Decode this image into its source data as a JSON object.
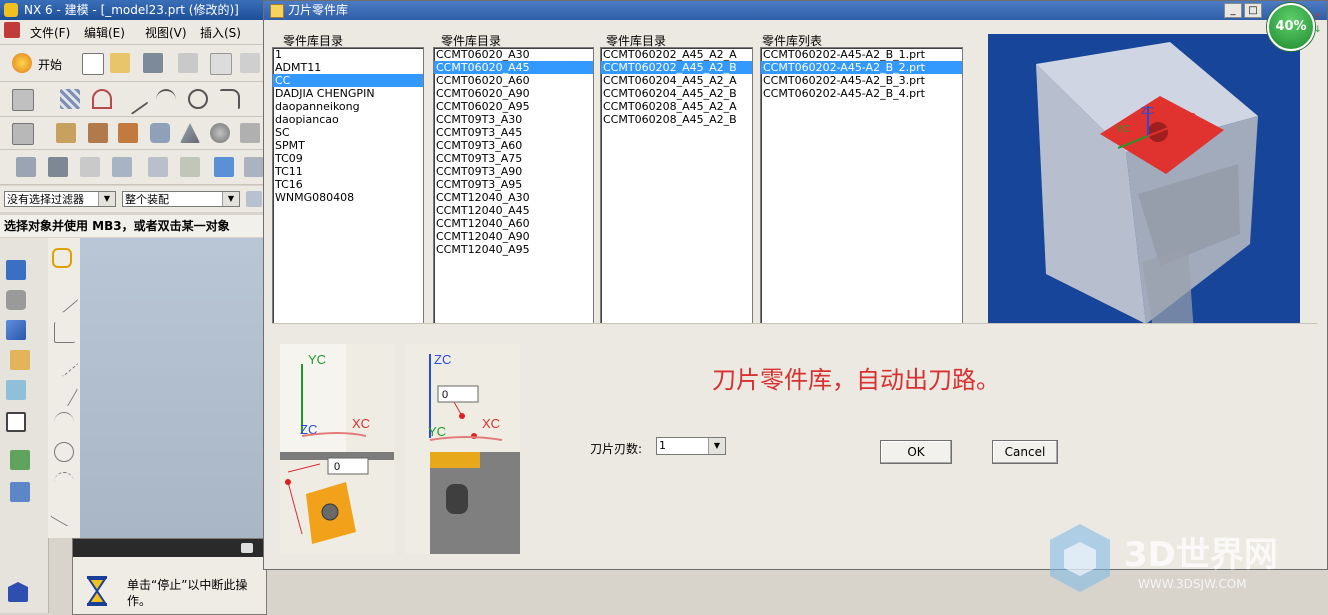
{
  "app": {
    "title": "NX 6 - 建模 - [_model23.prt (修改的)]",
    "menu": [
      "文件(F)",
      "编辑(E)",
      "视图(V)",
      "插入(S)"
    ],
    "start_label": "开始",
    "filter_value": "没有选择过滤器",
    "assembly_value": "整个装配",
    "prompt": "选择对象并使用 MB3，或者双击某一对象"
  },
  "stop_dialog": {
    "message": "单击“停止”以中断此操作。"
  },
  "dialog": {
    "title": "刀片零件库",
    "columns": [
      {
        "label": "零件库目录",
        "items": [
          "1",
          "ADMT11",
          "CC",
          "DADJIA CHENGPIN",
          "daopanneikong",
          "daopiancao",
          "SC",
          "SPMT",
          "TC09",
          "TC11",
          "TC16",
          "WNMG080408"
        ],
        "selected": 2
      },
      {
        "label": "零件库目录",
        "items": [
          "CCMT06020_A30",
          "CCMT06020_A45",
          "CCMT06020_A60",
          "CCMT06020_A90",
          "CCMT06020_A95",
          "CCMT09T3_A30",
          "CCMT09T3_A45",
          "CCMT09T3_A60",
          "CCMT09T3_A75",
          "CCMT09T3_A90",
          "CCMT09T3_A95",
          "CCMT12040_A30",
          "CCMT12040_A45",
          "CCMT12040_A60",
          "CCMT12040_A90",
          "CCMT12040_A95"
        ],
        "selected": 1
      },
      {
        "label": "零件库目录",
        "items": [
          "CCMT060202_A45_A2_A",
          "CCMT060202_A45_A2_B",
          "CCMT060204_A45_A2_A",
          "CCMT060204_A45_A2_B",
          "CCMT060208_A45_A2_A",
          "CCMT060208_A45_A2_B"
        ],
        "selected": 1
      },
      {
        "label": "零件库列表",
        "items": [
          "CCMT060202-A45-A2_B_1.prt",
          "CCMT060202-A45-A2_B_2.prt",
          "CCMT060202-A45-A2_B_3.prt",
          "CCMT060202-A45-A2_B_4.prt"
        ],
        "selected": 1
      }
    ],
    "caption": "刀片零件库，自动出刀路。",
    "count_label": "刀片刃数:",
    "count_value": "1",
    "ok_label": "OK",
    "cancel_label": "Cancel",
    "thumb1": {
      "yc": "YC",
      "zc": "ZC",
      "xc": "XC",
      "field": "0"
    },
    "thumb2": {
      "zc": "ZC",
      "yc": "YC",
      "xc": "XC",
      "field": "0"
    },
    "preview_axes": {
      "zc": "ZC",
      "yc": "YC",
      "xc": "XC"
    }
  },
  "overlay": {
    "zoom": "40%",
    "watermark_title": "3D世界网",
    "watermark_url": "WWW.3DSJW.COM"
  },
  "colors": {
    "selection": "#3399ff",
    "caption_red": "#d93030",
    "insert_orange": "#f2a21a",
    "preview_bg": "#17459a"
  }
}
